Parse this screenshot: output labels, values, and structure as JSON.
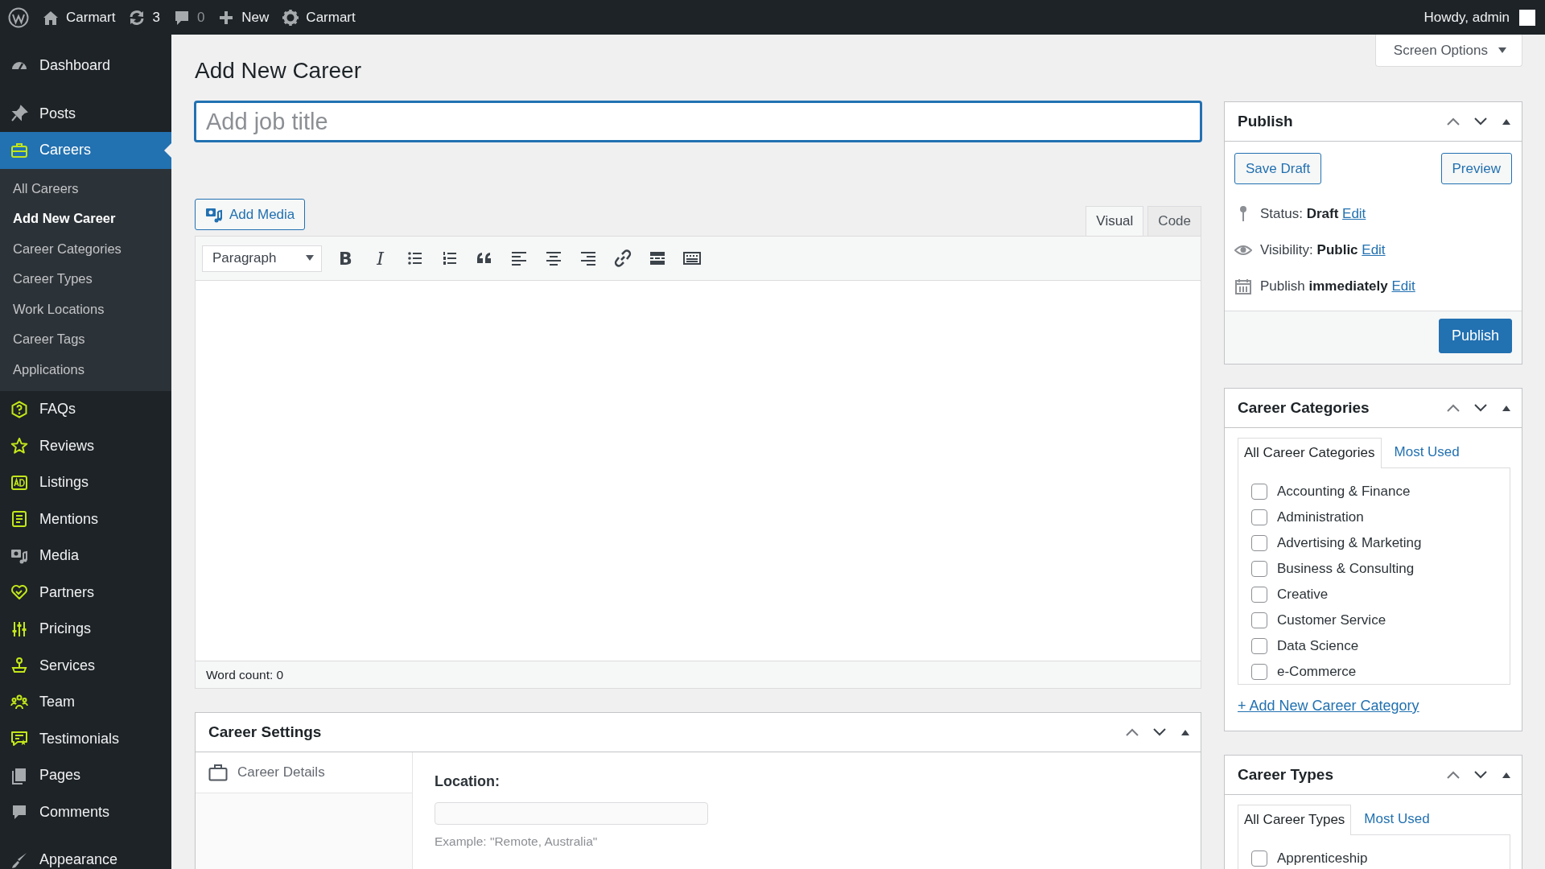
{
  "admin_bar": {
    "items": [
      {
        "label": "Carmart"
      },
      {
        "label": "3"
      },
      {
        "label": "0"
      },
      {
        "label": "New"
      },
      {
        "label": "Carmart"
      }
    ],
    "greeting": "Howdy, admin"
  },
  "sidebar": {
    "groups": [
      [
        {
          "label": "Dashboard",
          "selected": false
        }
      ],
      [
        {
          "label": "Posts",
          "selected": false
        },
        {
          "label": "Careers",
          "selected": true,
          "submenu": [
            {
              "label": "All Careers",
              "selected": false
            },
            {
              "label": "Add New Career",
              "selected": true
            },
            {
              "label": "Career Categories",
              "selected": false
            },
            {
              "label": "Career Types",
              "selected": false
            },
            {
              "label": "Work Locations",
              "selected": false
            },
            {
              "label": "Career Tags",
              "selected": false
            },
            {
              "label": "Applications",
              "selected": false
            }
          ]
        },
        {
          "label": "FAQs",
          "selected": false
        },
        {
          "label": "Reviews",
          "selected": false
        },
        {
          "label": "Listings",
          "selected": false
        },
        {
          "label": "Mentions",
          "selected": false
        },
        {
          "label": "Media",
          "selected": false
        },
        {
          "label": "Partners",
          "selected": false
        },
        {
          "label": "Pricings",
          "selected": false
        },
        {
          "label": "Services",
          "selected": false
        },
        {
          "label": "Team",
          "selected": false
        },
        {
          "label": "Testimonials",
          "selected": false
        },
        {
          "label": "Pages",
          "selected": false
        },
        {
          "label": "Comments",
          "selected": false
        }
      ],
      [
        {
          "label": "Appearance",
          "selected": false
        }
      ]
    ]
  },
  "screen_options": "Screen Options",
  "page_title": "Add New Career",
  "title_field": {
    "placeholder": "Add job title"
  },
  "add_media": "Add Media",
  "editor": {
    "tabs": [
      {
        "label": "Visual",
        "selected": true
      },
      {
        "label": "Code",
        "selected": false
      }
    ],
    "format_select": "Paragraph",
    "format_buttons": [
      "B",
      "I"
    ],
    "word_count": "Word count: 0"
  },
  "career_settings": {
    "title": "Career Settings",
    "tabs": [
      {
        "label": "Career Details",
        "selected": true
      }
    ],
    "fields": [
      {
        "label": "Location:",
        "hint": "Example: \"Remote, Australia\""
      }
    ]
  },
  "publish": {
    "title": "Publish",
    "save_draft": "Save Draft",
    "preview": "Preview",
    "meta": [
      {
        "text": "Status: **Draft**",
        "link": "Edit"
      },
      {
        "text": "Visibility: **Public**",
        "link": "Edit"
      },
      {
        "text": "Publish **immediately**",
        "link": "Edit"
      }
    ],
    "publish_button": "Publish"
  },
  "taxonomies": [
    {
      "title": "Career Categories",
      "tabs": [
        {
          "label": "All Career Categories",
          "selected": true
        },
        {
          "label": "Most Used",
          "selected": false
        }
      ],
      "items": [
        {
          "label": "Accounting & Finance",
          "checked": false
        },
        {
          "label": "Administration",
          "checked": false
        },
        {
          "label": "Advertising & Marketing",
          "checked": false
        },
        {
          "label": "Business & Consulting",
          "checked": false
        },
        {
          "label": "Creative",
          "checked": false
        },
        {
          "label": "Customer Service",
          "checked": false
        },
        {
          "label": "Data Science",
          "checked": false
        },
        {
          "label": "e-Commerce",
          "checked": false
        }
      ],
      "add_link": "+ Add New Career Category"
    },
    {
      "title": "Career Types",
      "tabs": [
        {
          "label": "All Career Types",
          "selected": true
        },
        {
          "label": "Most Used",
          "selected": false
        }
      ],
      "items": [
        {
          "label": "Apprenticeship",
          "checked": false
        }
      ]
    }
  ]
}
